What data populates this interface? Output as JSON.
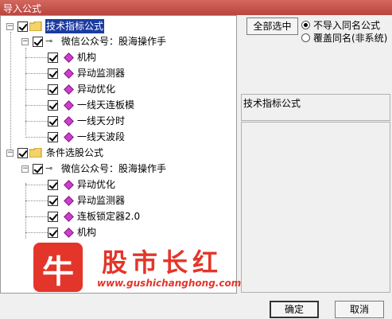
{
  "window": {
    "title": "导入公式"
  },
  "tree": {
    "groups": [
      {
        "label": "技术指标公式",
        "selected": true,
        "subgroup": "微信公众号：股海操作手",
        "items": [
          "机构",
          "异动监测器",
          "异动优化",
          "一线天连板模",
          "一线天分时",
          "一线天波段"
        ]
      },
      {
        "label": "条件选股公式",
        "selected": false,
        "subgroup": "微信公众号：股海操作手",
        "items": [
          "异动优化",
          "异动监测器",
          "连板锁定器2.0",
          "机构"
        ]
      }
    ]
  },
  "options": {
    "select_all_label": "全部选中",
    "radio_options": [
      {
        "label": "不导入同名公式",
        "checked": true
      },
      {
        "label": "覆盖同名(非系统)",
        "checked": false
      }
    ]
  },
  "info": {
    "label": "技术指标公式"
  },
  "watermark": {
    "logo_char": "牛",
    "brand": "股市长红",
    "url": "www.gushichanghong.com"
  },
  "footer": {
    "ok_label": "确定",
    "cancel_label": "取消"
  },
  "colors": {
    "titlebar": "#c0504d",
    "selection": "#1b3ba0",
    "diamond": "#d03bd0",
    "watermark": "#e4352a"
  }
}
